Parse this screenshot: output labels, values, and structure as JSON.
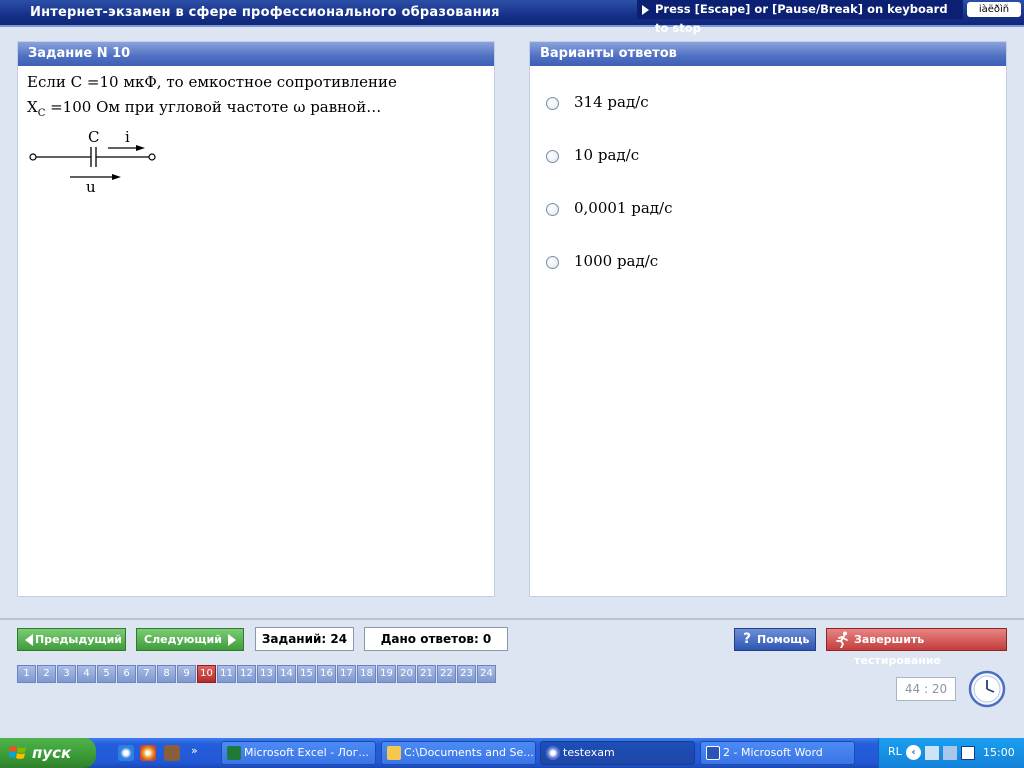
{
  "window": {
    "title": "Интернет-экзамен в сфере профессионального образования",
    "escape_hint": "Press [Escape] or [Pause/Break] on keyboard to stop",
    "lang_box": "iàëðìñ"
  },
  "task": {
    "header": "Задание N 10",
    "line1": "Если C =10  мкФ, то емкостное сопротивление",
    "line2_x": "X",
    "line2_sub": "C",
    "line2_rest": " =100  Ом при угловой частоте  ω  равной…",
    "circuit": {
      "c_label": "C",
      "i_label": "i",
      "u_label": "u"
    }
  },
  "answers": {
    "header": "Варианты ответов",
    "options": [
      "314 рад/с",
      "10 рад/с",
      "0,0001 рад/с",
      "1000 рад/с"
    ]
  },
  "controls": {
    "prev_label": "Предыдущий",
    "next_label": "Следующий",
    "tasks_count": "Заданий: 24",
    "answered_count": "Дано ответов: 0",
    "help_label": "Помощь",
    "finish_label": "Завершить тестирование",
    "timer": "44 : 20",
    "current_task": 10,
    "task_numbers": [
      "1",
      "2",
      "3",
      "4",
      "5",
      "6",
      "7",
      "8",
      "9",
      "10",
      "11",
      "12",
      "13",
      "14",
      "15",
      "16",
      "17",
      "18",
      "19",
      "20",
      "21",
      "22",
      "23",
      "24"
    ]
  },
  "taskbar": {
    "start_label": "пуск",
    "quick_more": "»",
    "tasks": [
      "Microsoft Excel - Лог...",
      "C:\\Documents and Se...",
      "testexam",
      "2 - Microsoft Word"
    ],
    "lang": "RL",
    "chevron": "‹",
    "time": "15:00"
  },
  "colors": {
    "title_bar": "#17318a",
    "panel_header": "#4f6fc2",
    "nav_button": "#3f9c3b",
    "help_button": "#2f56b2",
    "finish_button": "#c33d3d",
    "active_task_cell": "#b52b2b"
  }
}
